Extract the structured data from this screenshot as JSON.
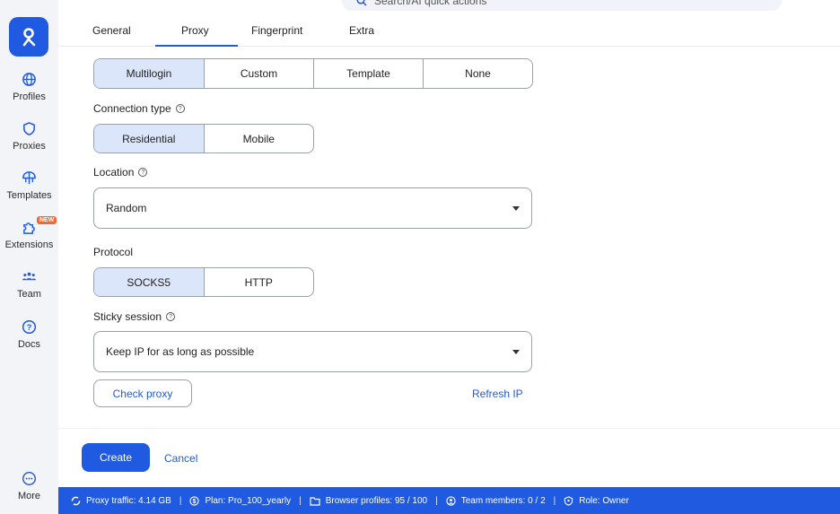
{
  "sidebar": {
    "items": [
      {
        "label": "Profiles"
      },
      {
        "label": "Proxies"
      },
      {
        "label": "Templates"
      },
      {
        "label": "Extensions",
        "badge": "NEW"
      },
      {
        "label": "Team"
      },
      {
        "label": "Docs"
      },
      {
        "label": "More"
      }
    ]
  },
  "search": {
    "placeholder": "Search/AI quick actions"
  },
  "tabs": [
    "General",
    "Proxy",
    "Fingerprint",
    "Extra"
  ],
  "active_tab": "Proxy",
  "proxy_source": {
    "options": [
      "Multilogin",
      "Custom",
      "Template",
      "None"
    ],
    "selected": "Multilogin"
  },
  "connection_type": {
    "label": "Connection type",
    "options": [
      "Residential",
      "Mobile"
    ],
    "selected": "Residential"
  },
  "location": {
    "label": "Location",
    "value": "Random"
  },
  "protocol": {
    "label": "Protocol",
    "options": [
      "SOCKS5",
      "HTTP"
    ],
    "selected": "SOCKS5"
  },
  "sticky_session": {
    "label": "Sticky session",
    "value": "Keep IP for as long as possible"
  },
  "actions": {
    "check_proxy": "Check proxy",
    "refresh_ip": "Refresh IP",
    "create": "Create",
    "cancel": "Cancel"
  },
  "statusbar": {
    "proxy_traffic": "Proxy traffic: 4.14 GB",
    "plan": "Plan: Pro_100_yearly",
    "browser_profiles": "Browser profiles: 95 / 100",
    "team_members": "Team members: 0 / 2",
    "role": "Role: Owner"
  },
  "colors": {
    "accent": "#1f5ae0",
    "selected_bg": "#dce6fb",
    "badge": "#f06b2e"
  }
}
